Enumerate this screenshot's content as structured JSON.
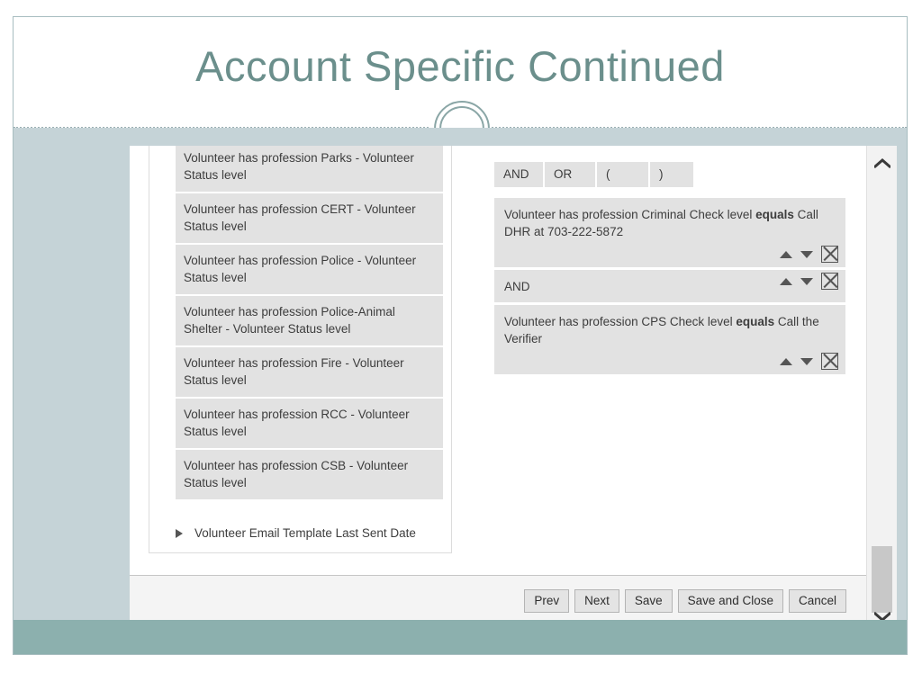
{
  "slide": {
    "title": "Account Specific Continued",
    "title_color": "#6b8f8c",
    "accent_bar_color": "#8cb0ae",
    "body_background": "#c5d3d7"
  },
  "tree_panel": {
    "items": [
      {
        "label": "Volunteer has profession Parks - Volunteer Status level"
      },
      {
        "label": "Volunteer has profession CERT - Volunteer Status level"
      },
      {
        "label": "Volunteer has profession Police - Volunteer Status level"
      },
      {
        "label": "Volunteer has profession Police-Animal Shelter - Volunteer Status level"
      },
      {
        "label": "Volunteer has profession Fire - Volunteer Status level"
      },
      {
        "label": "Volunteer has profession RCC - Volunteer Status level"
      },
      {
        "label": "Volunteer has profession CSB - Volunteer Status level"
      }
    ],
    "collapsed_node": {
      "label": "Volunteer Email Template Last Sent Date",
      "expander_icon": "triangle-right-icon"
    }
  },
  "criteria_panel": {
    "operators": [
      {
        "label": "AND"
      },
      {
        "label": "OR"
      },
      {
        "label": "("
      },
      {
        "label": ")"
      }
    ],
    "rows": [
      {
        "type": "criterion",
        "text_before": "Volunteer has profession Criminal Check level ",
        "operator": "equals",
        "text_after": " Call DHR at 703-222-5872",
        "move_up_icon": "triangle-up-icon",
        "move_down_icon": "triangle-down-icon",
        "delete_icon": "x-box-icon"
      },
      {
        "type": "conjunction",
        "text_before": "AND",
        "operator": "",
        "text_after": "",
        "move_up_icon": "triangle-up-icon",
        "move_down_icon": "triangle-down-icon",
        "delete_icon": "x-box-icon"
      },
      {
        "type": "criterion",
        "text_before": "Volunteer has profession CPS Check level ",
        "operator": "equals",
        "text_after": " Call the Verifier",
        "move_up_icon": "triangle-up-icon",
        "move_down_icon": "triangle-down-icon",
        "delete_icon": "x-box-icon"
      }
    ]
  },
  "footer": {
    "buttons": [
      {
        "label": "Prev"
      },
      {
        "label": "Next"
      },
      {
        "label": "Save"
      },
      {
        "label": "Save and Close"
      },
      {
        "label": "Cancel"
      }
    ]
  },
  "scrollbar": {
    "up_icon": "chevron-up-icon",
    "down_icon": "chevron-down-icon"
  }
}
